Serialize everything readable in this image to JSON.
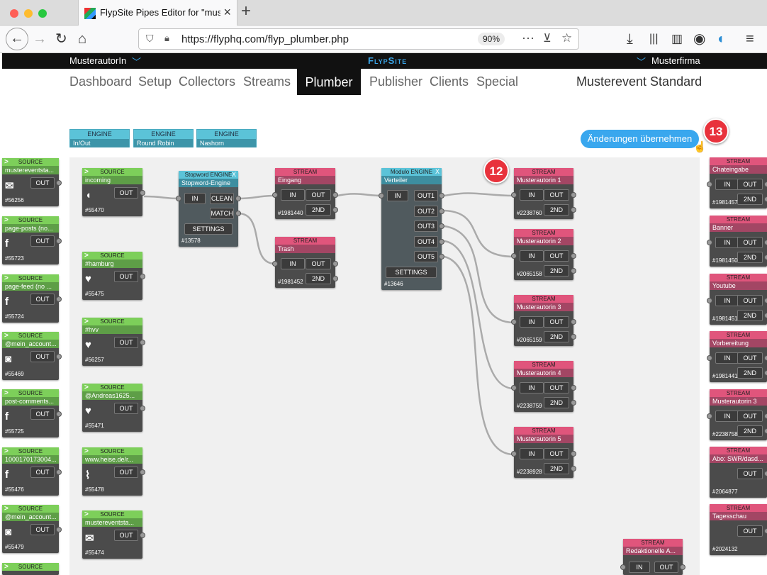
{
  "browser": {
    "tab_title": "FlypSite Pipes Editor for \"muste",
    "url": "https://flyphq.com/flyp_plumber.php",
    "zoom": "90%"
  },
  "app": {
    "user": "MusterautorIn",
    "brand": "FlypSite",
    "company": "Musterfirma",
    "menu": [
      "Dashboard",
      "Setup",
      "Collectors",
      "Streams",
      "Plumber",
      "Publisher",
      "Clients",
      "Special"
    ],
    "event": "Musterevent Standard"
  },
  "engines": [
    {
      "type": "ENGINE",
      "name": "In/Out"
    },
    {
      "type": "ENGINE",
      "name": "Round Robin"
    },
    {
      "type": "ENGINE",
      "name": "Nashorn"
    }
  ],
  "apply_label": "Änderungen übernehmen",
  "badges": [
    "13",
    "12"
  ],
  "labels": {
    "source": "SOURCE",
    "stream": "STREAM",
    "in": "IN",
    "out": "OUT",
    "second": "2ND",
    "settings": "SETTINGS",
    "clean": "CLEAN",
    "match": "MATCH",
    "close": "X"
  },
  "left_sources": [
    {
      "name": "mustereventsta...",
      "icon": "mail-icon",
      "id": "#56256"
    },
    {
      "name": "page-posts (no...",
      "icon": "facebook-icon",
      "id": "#55723"
    },
    {
      "name": "page-feed (no ...",
      "icon": "facebook-icon",
      "id": "#55724"
    },
    {
      "name": "@mein_account...",
      "icon": "instagram-icon",
      "id": "#55469"
    },
    {
      "name": "post-comments...",
      "icon": "facebook-icon",
      "id": "#55725"
    },
    {
      "name": "1000170173004...",
      "icon": "facebook-icon",
      "id": "#55476"
    },
    {
      "name": "@mein_account...",
      "icon": "instagram-icon",
      "id": "#55479"
    },
    {
      "name": "",
      "icon": "",
      "id": ""
    }
  ],
  "sources": [
    {
      "name": "incoming",
      "icon": "dolphin-icon",
      "id": "#55470"
    },
    {
      "name": "#hamburg",
      "icon": "twitter-icon",
      "id": "#55475"
    },
    {
      "name": "#hvv",
      "icon": "twitter-icon",
      "id": "#56257"
    },
    {
      "name": "@Andreas1625...",
      "icon": "twitter-icon",
      "id": "#55471"
    },
    {
      "name": "www.heise.de/r...",
      "icon": "rss-icon",
      "id": "#55478"
    },
    {
      "name": "mustereventsta...",
      "icon": "mail-icon",
      "id": "#55474"
    }
  ],
  "stopword": {
    "header": "Stopword ENGINE",
    "name": "Stopword-Engine",
    "id": "#13578"
  },
  "modulo": {
    "header": "Modulo ENGINE",
    "name": "Verteiler",
    "id": "#13646",
    "outs": [
      "OUT1",
      "OUT2",
      "OUT3",
      "OUT4",
      "OUT5"
    ]
  },
  "mid_streams": [
    {
      "name": "Eingang",
      "id": "#1981440"
    },
    {
      "name": "Trash",
      "id": "#1981452"
    }
  ],
  "out_streams": [
    {
      "name": "Musterautorin 1",
      "id": "#2238760"
    },
    {
      "name": "Musterautorin 2",
      "id": "#2065158"
    },
    {
      "name": "Musterautorin 3",
      "id": "#2065159"
    },
    {
      "name": "Musterautorin 4",
      "id": "#2238759"
    },
    {
      "name": "Musterautorin 5",
      "id": "#2238928"
    }
  ],
  "right_streams": [
    {
      "name": "Chateingabe",
      "id": "#1981457",
      "has_in": true
    },
    {
      "name": "Banner",
      "id": "#1981450",
      "has_in": true
    },
    {
      "name": "Youtube",
      "id": "#1981451",
      "has_in": true
    },
    {
      "name": "Vorbereitung",
      "id": "#1981441",
      "has_in": true
    },
    {
      "name": "Musterautorin 3",
      "id": "#2238758",
      "has_in": true
    },
    {
      "name": "Abo: SWR/dasd...",
      "id": "#2064877",
      "has_in": false
    },
    {
      "name": "Tagesschau",
      "id": "#2024132",
      "has_in": false
    }
  ],
  "bottom_stream": {
    "name": "Redaktionelle A..."
  },
  "colors": {
    "source": "#7dcf5a",
    "stream": "#e0557c",
    "engine": "#5bc3d8",
    "accent": "#39a7ee",
    "badge": "#e8323c"
  }
}
